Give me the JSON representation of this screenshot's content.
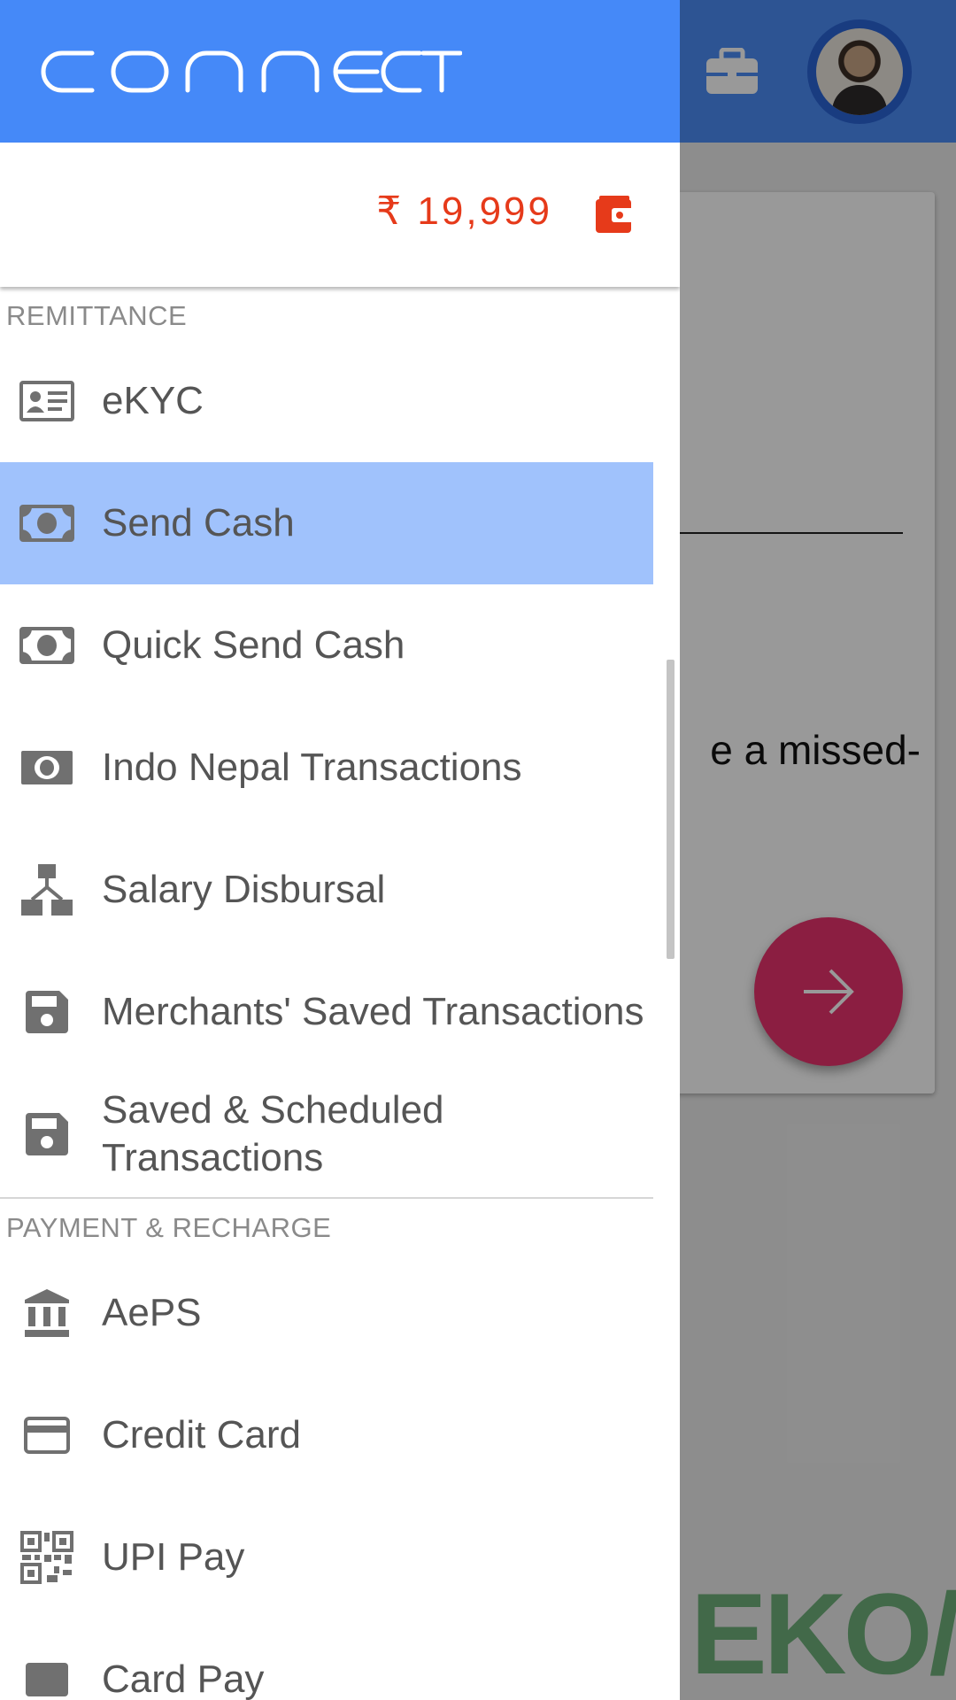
{
  "app": {
    "background_card_text": "e a missed-",
    "background_watermark": "EKO/-"
  },
  "drawer": {
    "brand": "CONNECT",
    "wallet": {
      "balance": "₹ 19,999"
    },
    "sections": [
      {
        "label": "REMITTANCE",
        "items": [
          {
            "label": "eKYC",
            "icon": "id-card-icon"
          },
          {
            "label": "Send Cash",
            "icon": "cash-icon",
            "selected": true
          },
          {
            "label": "Quick Send Cash",
            "icon": "cash-icon"
          },
          {
            "label": "Indo Nepal Transactions",
            "icon": "cash-icon"
          },
          {
            "label": "Salary Disbursal",
            "icon": "hierarchy-icon"
          },
          {
            "label": "Merchants' Saved Transactions",
            "icon": "save-icon"
          },
          {
            "label": "Saved & Scheduled Transactions",
            "icon": "save-icon"
          }
        ]
      },
      {
        "label": "PAYMENT & RECHARGE",
        "items": [
          {
            "label": "AePS",
            "icon": "bank-icon"
          },
          {
            "label": "Credit Card",
            "icon": "credit-card-icon"
          },
          {
            "label": "UPI Pay",
            "icon": "qr-code-icon"
          },
          {
            "label": "Card Pay",
            "icon": "card-icon"
          }
        ]
      }
    ]
  },
  "colors": {
    "header_blue": "#4589f8",
    "selected_item": "#a0c2fc",
    "wallet_red": "#e63a1a",
    "fab_pink": "#e8336d"
  }
}
